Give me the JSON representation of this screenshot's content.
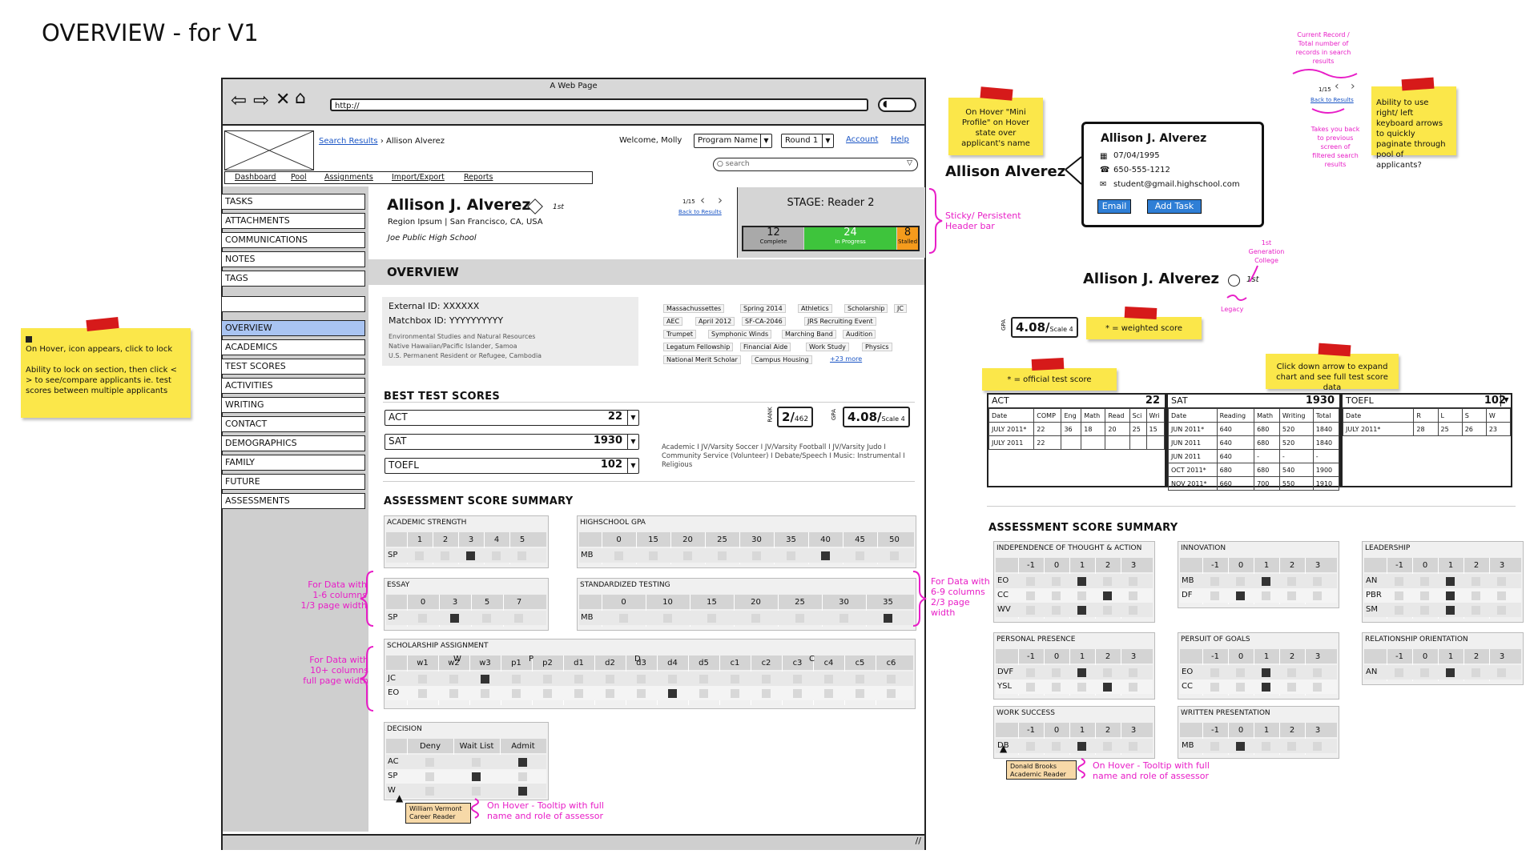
{
  "page_title": "OVERVIEW - for V1",
  "browser": {
    "window_title": "A Web Page",
    "url": "http://"
  },
  "app": {
    "breadcrumb": {
      "link": "Search Results",
      "current": "Allison Alverez"
    },
    "welcome": "Welcome, Molly",
    "program_select": "Program Name",
    "round_select": "Round 1",
    "account_link": "Account",
    "help_link": "Help",
    "search_placeholder": "search",
    "nav": [
      "Dashboard",
      "Pool",
      "Assignments",
      "Import/Export",
      "Reports"
    ],
    "side_top": [
      "TASKS",
      "ATTACHMENTS",
      "COMMUNICATIONS",
      "NOTES",
      "TAGS"
    ],
    "side_sections": [
      "OVERVIEW",
      "ACADEMICS",
      "TEST SCORES",
      "ACTIVITIES",
      "WRITING",
      "CONTACT",
      "DEMOGRAPHICS",
      "FAMILY",
      "FUTURE",
      "ASSESSMENTS"
    ]
  },
  "applicant": {
    "name": "Allison J. Alverez",
    "rank_badge": "1st",
    "location": "Region Ipsum | San Francisco, CA, USA",
    "school": "Joe Public High School",
    "pager": "1/15",
    "back_link": "Back to Results",
    "stage": "STAGE: Reader 2",
    "stage_counts": [
      {
        "value": "12",
        "label": "Complete"
      },
      {
        "value": "24",
        "label": "In Progress"
      },
      {
        "value": "8",
        "label": "Stalled"
      }
    ],
    "external_id": "External ID:   XXXXXX",
    "matchbox_id": "Matchbox ID:  YYYYYYYYYY",
    "details": [
      "Environmental Studies and Natural Resources",
      "Native Hawaiian/Pacific Islander, Samoa",
      "U.S. Permanent Resident or Refugee, Cambodia"
    ],
    "tags": [
      "Massachussettes",
      "Spring 2014",
      "Athletics",
      "Scholarship",
      "JC",
      "AEC",
      "April 2012",
      "SF-CA-2046",
      "JRS Recruiting Event",
      "Trumpet",
      "Symphonic Winds",
      "Marching Band",
      "Audition",
      "Legatum Fellowship",
      "Financial Aide",
      "Work Study",
      "Physics",
      "National Merit Scholar",
      "Campus Housing"
    ],
    "more_tags": "+23 more"
  },
  "overview": {
    "header": "OVERVIEW",
    "best_test_scores": "BEST TEST SCORES",
    "tests": [
      {
        "name": "ACT",
        "score": "22"
      },
      {
        "name": "SAT",
        "score": "1930"
      },
      {
        "name": "TOEFL",
        "score": "102"
      }
    ],
    "rank": {
      "label": "RANK",
      "value": "2",
      "of": "462"
    },
    "gpa": {
      "label": "GPA",
      "value": "4.08",
      "scale": "Scale 4"
    },
    "activities": "Academic I  JV/Varsity Soccer  I  JV/Varsity Football  I  JV/Varsity Judo  I  Community Service (Volunteer)  I  Debate/Speech I Music: Instrumental  I  Religious",
    "assessment_title": "ASSESSMENT SCORE SUMMARY",
    "academic_strength": {
      "title": "ACADEMIC STRENGTH",
      "cols": [
        "1",
        "2",
        "3",
        "4",
        "5"
      ],
      "rows": [
        "SP"
      ]
    },
    "hs_gpa": {
      "title": "HIGHSCHOOL GPA",
      "cols": [
        "0",
        "15",
        "20",
        "25",
        "30",
        "35",
        "40",
        "45",
        "50"
      ],
      "rows": [
        "MB"
      ]
    },
    "essay": {
      "title": "ESSAY",
      "cols": [
        "0",
        "3",
        "5",
        "7"
      ],
      "rows": [
        "SP"
      ]
    },
    "std_testing": {
      "title": "STANDARDIZED TESTING",
      "cols": [
        "0",
        "10",
        "15",
        "20",
        "25",
        "30",
        "35"
      ],
      "rows": [
        "MB"
      ]
    },
    "scholarship": {
      "title": "SCHOLARSHIP ASSIGNMENT",
      "groups": [
        "W",
        "P",
        "D",
        "C"
      ],
      "cols": [
        "w1",
        "w2",
        "w3",
        "p1",
        "p2",
        "d1",
        "d2",
        "d3",
        "d4",
        "d5",
        "c1",
        "c2",
        "c3",
        "c4",
        "c5",
        "c6"
      ],
      "rows": [
        "JC",
        "EO"
      ]
    },
    "decision": {
      "title": "DECISION",
      "cols": [
        "Deny",
        "Wait List",
        "Admit"
      ],
      "rows": [
        "AC",
        "SP",
        "W"
      ]
    },
    "tooltip": {
      "name": "William Vermont",
      "role": "Career Reader"
    }
  },
  "right": {
    "mini_name": "Allison Alverez",
    "profile": {
      "name": "Allison J. Alverez",
      "dob": "07/04/1995",
      "phone": "650-555-1212",
      "email": "student@gmail.highschool.com",
      "email_btn": "Email",
      "task_btn": "Add Task"
    },
    "pager": "1/15",
    "back_link": "Back to Results",
    "name2": "Allison J. Alverez",
    "rank2": "1st",
    "gpa_value": "4.08",
    "gpa_scale": "Scale 4",
    "gpa_label": "GPA",
    "act": {
      "label": "ACT",
      "score": "22",
      "cols": [
        "Date",
        "COMP",
        "Eng",
        "Math",
        "Read",
        "Sci",
        "Wri"
      ],
      "rows": [
        [
          "JULY 2011*",
          "22",
          "36",
          "18",
          "20",
          "25",
          "15"
        ],
        [
          "JULY 2011",
          "22",
          "",
          "",
          "",
          "",
          ""
        ]
      ]
    },
    "sat": {
      "label": "SAT",
      "score": "1930",
      "cols": [
        "Date",
        "Reading",
        "Math",
        "Writing",
        "Total"
      ],
      "rows": [
        [
          "JUN 2011*",
          "640",
          "680",
          "520",
          "1840"
        ],
        [
          "JUN 2011",
          "640",
          "680",
          "520",
          "1840"
        ],
        [
          "JUN 2011",
          "640",
          "-",
          "-",
          "-"
        ],
        [
          "OCT 2011*",
          "680",
          "680",
          "540",
          "1900"
        ],
        [
          "NOV 2011*",
          "660",
          "700",
          "550",
          "1910"
        ]
      ]
    },
    "toefl": {
      "label": "TOEFL",
      "score": "102",
      "cols": [
        "Date",
        "R",
        "L",
        "S",
        "W"
      ],
      "rows": [
        [
          "JULY 2011*",
          "28",
          "25",
          "26",
          "23"
        ]
      ]
    },
    "assessment_title": "ASSESSMENT SCORE SUMMARY",
    "grids": [
      {
        "title": "INDEPENDENCE OF THOUGHT & ACTION",
        "rows": [
          "EO",
          "CC",
          "WV"
        ]
      },
      {
        "title": "INNOVATION",
        "rows": [
          "MB",
          "DF"
        ]
      },
      {
        "title": "LEADERSHIP",
        "rows": [
          "AN",
          "PBR",
          "SM"
        ]
      },
      {
        "title": "PERSONAL PRESENCE",
        "rows": [
          "DVF",
          "YSL"
        ]
      },
      {
        "title": "PERSUIT OF GOALS",
        "rows": [
          "EO",
          "CC"
        ]
      },
      {
        "title": "RELATIONSHIP ORIENTATION",
        "rows": [
          "AN"
        ]
      },
      {
        "title": "WORK SUCCESS",
        "rows": [
          "DB"
        ]
      },
      {
        "title": "WRITTEN PRESENTATION",
        "rows": [
          "MB"
        ]
      }
    ],
    "grid_cols": [
      "-1",
      "0",
      "1",
      "2",
      "3"
    ],
    "tooltip": {
      "name": "Donald Brooks",
      "role": "Academic Reader"
    }
  },
  "annotations": {
    "lock_note": "On Hover, icon appears, click to lock\n\nAbility to lock on section, then click < > to see/compare applicants ie. test scores between multiple applicants",
    "hover_note": "On Hover \"Mini Profile\" on Hover state over applicant's name",
    "arrow_note": "Ability to use right/ left keyboard arrows to quickly paginate through pool of applicants?",
    "current_record": "Current Record / Total number of records in search results",
    "takes_back": "Takes you back to previous screen of filtered search results",
    "sticky_header": "Sticky/ Persistent Header bar",
    "first_gen": "1st Generation College",
    "legacy": "Legacy",
    "weighted": "* = weighted score",
    "official": "* = official test score",
    "expand_chart": "Click down arrow to expand chart and see full test score data",
    "data_16": "For Data with 1-6 columns 1/3 page width",
    "data_69": "For Data with 6-9 columns 2/3 page width",
    "data_10": "For Data with 10+ columns full page width",
    "tooltip_note": "On Hover - Tooltip with full name and role of assessor",
    "tooltip_note2": "On Hover - Tooltip with full name and role of assessor"
  }
}
